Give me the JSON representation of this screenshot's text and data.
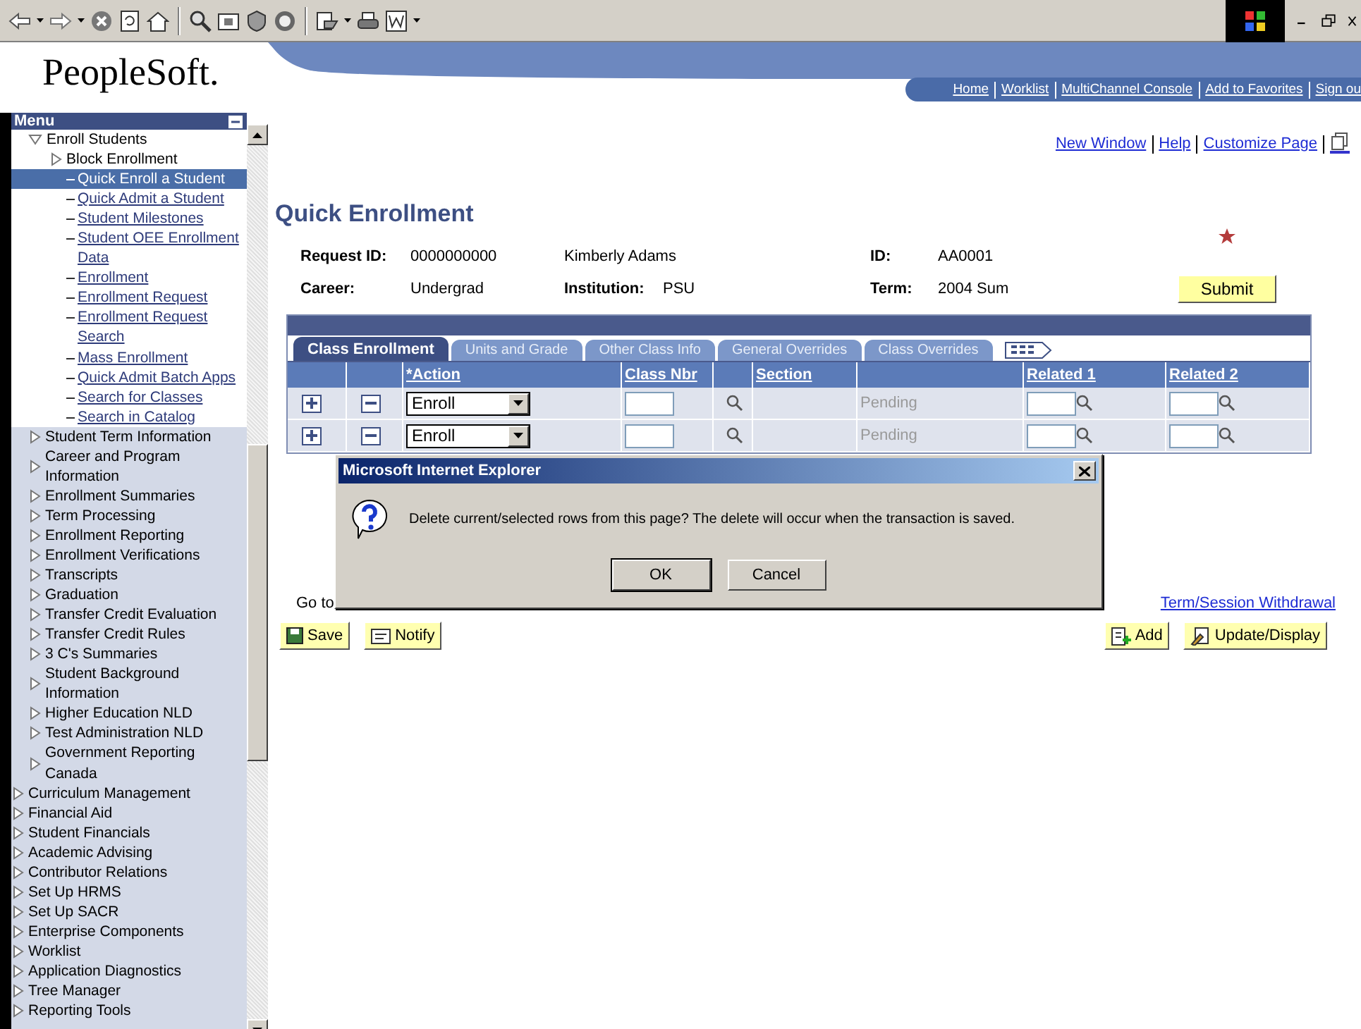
{
  "header": {
    "logo": "PeopleSoft.",
    "links": [
      "Home",
      "Worklist",
      "MultiChannel Console",
      "Add to Favorites",
      "Sign ou"
    ]
  },
  "menu": {
    "title": "Menu",
    "scrolled_section": [
      {
        "label": "Enroll Students",
        "kind": "folder",
        "expanded": true,
        "children": [
          {
            "label": "Block Enrollment",
            "kind": "folder",
            "expanded": false
          },
          {
            "label": "Quick Enroll a Student",
            "kind": "page",
            "selected": true
          },
          {
            "label": "Quick Admit a Student",
            "kind": "page",
            "selected": false
          },
          {
            "label": "Student Milestones",
            "kind": "page",
            "selected": false
          },
          {
            "label": "Student OEE Enrollment Data",
            "kind": "page",
            "selected": false
          },
          {
            "label": "Enrollment",
            "kind": "page",
            "selected": false
          },
          {
            "label": "Enrollment Request",
            "kind": "page",
            "selected": false
          },
          {
            "label": "Enrollment Request Search",
            "kind": "page",
            "selected": false
          },
          {
            "label": "Mass Enrollment",
            "kind": "page",
            "selected": false
          },
          {
            "label": "Quick Admit Batch Apps",
            "kind": "page",
            "selected": false
          },
          {
            "label": "Search for Classes",
            "kind": "page",
            "selected": false
          },
          {
            "label": "Search in Catalog",
            "kind": "page",
            "selected": false
          }
        ]
      },
      {
        "label": "Student Term Information",
        "kind": "folder",
        "expanded": false
      },
      {
        "label": "Career and Program Information",
        "kind": "folder",
        "expanded": false
      },
      {
        "label": "Enrollment Summaries",
        "kind": "folder",
        "expanded": false
      },
      {
        "label": "Term Processing",
        "kind": "folder",
        "expanded": false
      },
      {
        "label": "Enrollment Reporting",
        "kind": "folder",
        "expanded": false
      },
      {
        "label": "Enrollment Verifications",
        "kind": "folder",
        "expanded": false
      },
      {
        "label": "Transcripts",
        "kind": "folder",
        "expanded": false
      },
      {
        "label": "Graduation",
        "kind": "folder",
        "expanded": false
      },
      {
        "label": "Transfer Credit Evaluation",
        "kind": "folder",
        "expanded": false
      },
      {
        "label": "Transfer Credit Rules",
        "kind": "folder",
        "expanded": false
      },
      {
        "label": "3 C's Summaries",
        "kind": "folder",
        "expanded": false
      },
      {
        "label": "Student Background Information",
        "kind": "folder",
        "expanded": false
      },
      {
        "label": "Higher Education NLD",
        "kind": "folder",
        "expanded": false
      },
      {
        "label": "Test Administration NLD",
        "kind": "folder",
        "expanded": false
      },
      {
        "label": "Government Reporting Canada",
        "kind": "folder",
        "expanded": false
      }
    ],
    "items": [
      {
        "label": "Curriculum Management",
        "kind": "folder",
        "expanded": false
      },
      {
        "label": "Financial Aid",
        "kind": "folder",
        "expanded": false
      },
      {
        "label": "Student Financials",
        "kind": "folder",
        "expanded": false
      },
      {
        "label": "Academic Advising",
        "kind": "folder",
        "expanded": false
      },
      {
        "label": "Contributor Relations",
        "kind": "folder",
        "expanded": false
      },
      {
        "label": "Set Up HRMS",
        "kind": "folder",
        "expanded": false
      },
      {
        "label": "Set Up SACR",
        "kind": "folder",
        "expanded": false
      },
      {
        "label": "Enterprise Components",
        "kind": "folder",
        "expanded": false
      },
      {
        "label": "Worklist",
        "kind": "folder",
        "expanded": false
      },
      {
        "label": "Application Diagnostics",
        "kind": "folder",
        "expanded": false
      },
      {
        "label": "Tree Manager",
        "kind": "folder",
        "expanded": false
      },
      {
        "label": "Reporting Tools",
        "kind": "folder",
        "expanded": false
      }
    ]
  },
  "page_links": [
    "New Window",
    "Help",
    "Customize Page"
  ],
  "title": "Quick Enrollment",
  "details": {
    "request_id": {
      "label": "Request ID:",
      "value": "0000000000"
    },
    "name": "Kimberly Adams",
    "id": {
      "label": "ID:",
      "value": "AA0001"
    },
    "career": {
      "label": "Career:",
      "value": "Undergrad"
    },
    "institution": {
      "label": "Institution:",
      "value": "PSU"
    },
    "term": {
      "label": "Term:",
      "value": "2004 Sum"
    }
  },
  "submit": "Submit",
  "grid": {
    "tabs": [
      {
        "label": "Class Enrollment",
        "selected": true
      },
      {
        "label": "Units and Grade",
        "selected": false
      },
      {
        "label": "Other Class Info",
        "selected": false
      },
      {
        "label": "General Overrides",
        "selected": false
      },
      {
        "label": "Class Overrides",
        "selected": false
      }
    ],
    "columns": {
      "action": "*Action",
      "class_nbr": "Class Nbr",
      "section": "Section",
      "related_1": "Related 1",
      "related_2": "Related 2"
    },
    "rows": [
      {
        "action": "Enroll",
        "status": "Pending"
      },
      {
        "action": "Enroll",
        "status": "Pending"
      }
    ]
  },
  "goto": {
    "label": "Go to",
    "links": [
      "Term/Session Withdrawal"
    ]
  },
  "buttons_left": [
    "Save",
    "Notify"
  ],
  "buttons_right": [
    "Add",
    "Update/Display"
  ],
  "dialog": {
    "title": "Microsoft Internet Explorer",
    "message": "Delete current/selected rows from this page?  The delete will occur when the transaction is saved.",
    "buttons": [
      "OK",
      "Cancel"
    ]
  }
}
